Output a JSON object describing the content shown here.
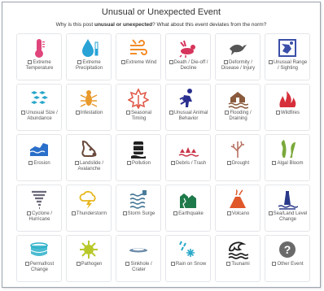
{
  "header": {
    "title": "Unusual or Unexpected Event",
    "subtitle_pre": "Why is this post ",
    "subtitle_bold": "unusual or unexpected",
    "subtitle_post": "? What about this event deviates from the norm?"
  },
  "events": [
    {
      "label": "Extreme Temperature",
      "icon": "thermometer-icon",
      "color": "#e0457b"
    },
    {
      "label": "Extreme Precipitation",
      "icon": "raindrop-icon",
      "color": "#29a3d6"
    },
    {
      "label": "Extreme Wind",
      "icon": "wind-icon",
      "color": "#f28c28"
    },
    {
      "label": "Death / Die-off / Decline",
      "icon": "dead-bird-icon",
      "color": "#d6345c"
    },
    {
      "label": "Deformity / Disease / Injury",
      "icon": "bird-icon",
      "color": "#555555"
    },
    {
      "label": "Unusual Range / Sighting",
      "icon": "map-range-icon",
      "color": "#3b4fa8"
    },
    {
      "label": "Unusual Size / Abundance",
      "icon": "fish-school-icon",
      "color": "#2aa8c9"
    },
    {
      "label": "Infestation",
      "icon": "insect-icon",
      "color": "#e89a2c"
    },
    {
      "label": "Seasonal Timing",
      "icon": "leaf-icon",
      "color": "#e05a4a"
    },
    {
      "label": "Unusual Animal Behavior",
      "icon": "animal-behavior-icon",
      "color": "#2a2f8f"
    },
    {
      "label": "Flooding / Draining",
      "icon": "flood-icon",
      "color": "#8a5a3c"
    },
    {
      "label": "Wildfires",
      "icon": "fire-icon",
      "color": "#d62f3a"
    },
    {
      "label": "Erosion",
      "icon": "erosion-icon",
      "color": "#2a6fc9"
    },
    {
      "label": "Landslide / Avalanche",
      "icon": "landslide-icon",
      "color": "#6a4a3c"
    },
    {
      "label": "Pollution",
      "icon": "barrel-icon",
      "color": "#222222"
    },
    {
      "label": "Debris / Trash",
      "icon": "debris-icon",
      "color": "#c9364a"
    },
    {
      "label": "Drought",
      "icon": "dry-tree-icon",
      "color": "#b46a5a"
    },
    {
      "label": "Algal Bloom",
      "icon": "algae-icon",
      "color": "#7aa83a"
    },
    {
      "label": "Cyclone / Hurricane",
      "icon": "cyclone-icon",
      "color": "#6a6a7a"
    },
    {
      "label": "Thunderstorm",
      "icon": "thunderstorm-icon",
      "color": "#e8b820"
    },
    {
      "label": "Storm Surge",
      "icon": "storm-surge-icon",
      "color": "#4a7a9a"
    },
    {
      "label": "Earthquake",
      "icon": "earthquake-icon",
      "color": "#1e7a4a"
    },
    {
      "label": "Volcano",
      "icon": "volcano-icon",
      "color": "#e0572a"
    },
    {
      "label": "Sea/Land Level Change",
      "icon": "lighthouse-icon",
      "color": "#2a3a8a"
    },
    {
      "label": "Permafrost Change",
      "icon": "permafrost-icon",
      "color": "#2ab0c9"
    },
    {
      "label": "Pathogen",
      "icon": "virus-icon",
      "color": "#b8c82a"
    },
    {
      "label": "Sinkhole / Crater",
      "icon": "sinkhole-icon",
      "color": "#6a8aa8"
    },
    {
      "label": "Rain on Snow",
      "icon": "rain-snow-icon",
      "color": "#2aa8c9"
    },
    {
      "label": "Tsunami",
      "icon": "tsunami-icon",
      "color": "#222222"
    },
    {
      "label": "Other Event",
      "icon": "question-icon",
      "color": "#6a6a6a"
    }
  ]
}
